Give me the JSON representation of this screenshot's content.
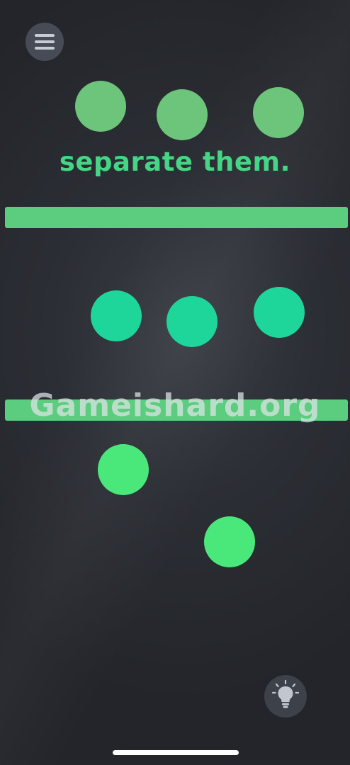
{
  "game": {
    "instruction": "separate them.",
    "watermark": "Gameishard.org",
    "colors": {
      "background": "#2b2e34",
      "top_circles": "#6cc57b",
      "middle_circles": "#1fd69a",
      "bottom_circles": "#4ae87a",
      "walls": "#5ccc7f",
      "instruction_text": "#45d685"
    }
  },
  "controls": {
    "menu_icon": "hamburger-menu-icon",
    "hint_icon": "lightbulb-icon"
  }
}
